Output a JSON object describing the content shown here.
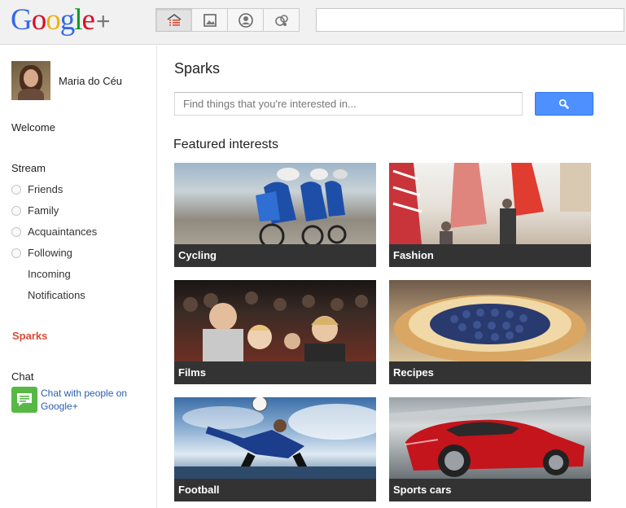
{
  "header": {
    "logo_text": "Google+",
    "nav": [
      "home-icon",
      "photos-icon",
      "profile-icon",
      "circles-icon"
    ],
    "search_value": ""
  },
  "sidebar": {
    "profile_name": "Maria do Céu",
    "welcome": "Welcome",
    "stream": "Stream",
    "circles": [
      "Friends",
      "Family",
      "Acquaintances",
      "Following"
    ],
    "extras": [
      "Incoming",
      "Notifications"
    ],
    "sparks": "Sparks",
    "chat_label": "Chat",
    "chat_link": "Chat with people on Google+"
  },
  "main": {
    "title": "Sparks",
    "search_placeholder": "Find things that you're interested in...",
    "section_title": "Featured interests",
    "interests": [
      "Cycling",
      "Fashion",
      "Films",
      "Recipes",
      "Football",
      "Sports cars"
    ]
  },
  "colors": {
    "accent_blue": "#4d90fe",
    "sparks_red": "#dd4b39",
    "link_blue": "#2a5db0",
    "caption_bg": "#333333"
  }
}
